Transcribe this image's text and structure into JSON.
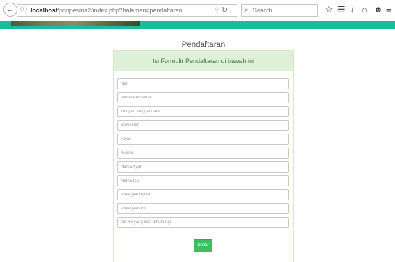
{
  "browser": {
    "url_host": "localhost",
    "url_path": "/ponpesma2/index.php?halaman=pendaftaran",
    "search_placeholder": "Search",
    "icons": [
      "back-arrow-icon",
      "info-icon",
      "dropdown-icon",
      "reload-icon",
      "search-icon",
      "star-icon",
      "reading-list-icon",
      "download-icon",
      "home-icon",
      "pocket-icon",
      "menu-icon"
    ]
  },
  "page": {
    "title": "Pendaftaran",
    "panel_heading": "Isi Formulir Pendaftaran di bawah ini",
    "fields": [
      {
        "name": "nim",
        "placeholder": "NIM",
        "value": ""
      },
      {
        "name": "nama-pendaftar",
        "placeholder": "Nama Pendaftar",
        "value": ""
      },
      {
        "name": "tempat-tanggal-lahir",
        "placeholder": "Tempat Tanggal Lahir",
        "value": ""
      },
      {
        "name": "semester",
        "placeholder": "Semester",
        "value": ""
      },
      {
        "name": "kelas",
        "placeholder": "Kelas",
        "value": ""
      },
      {
        "name": "alamat",
        "placeholder": "Alamat",
        "value": ""
      },
      {
        "name": "nama-ayah",
        "placeholder": "Nama Ayah",
        "value": ""
      },
      {
        "name": "nama-ibu",
        "placeholder": "Nama Ibu",
        "value": ""
      },
      {
        "name": "pekerjaan-ayah",
        "placeholder": "Pekerjaan Ayah",
        "value": ""
      },
      {
        "name": "pekerjaan-ibu",
        "placeholder": "Pekerjaan Ibu",
        "value": ""
      },
      {
        "name": "no-hp",
        "placeholder": "No Hp yang bisa dihubungi",
        "value": ""
      }
    ],
    "submit_label": "Daftar"
  },
  "colors": {
    "header_teal": "#1abc9c",
    "panel_heading_bg": "#dff0d8",
    "panel_heading_text": "#3c763d",
    "submit_bg": "#3cbf5e"
  }
}
